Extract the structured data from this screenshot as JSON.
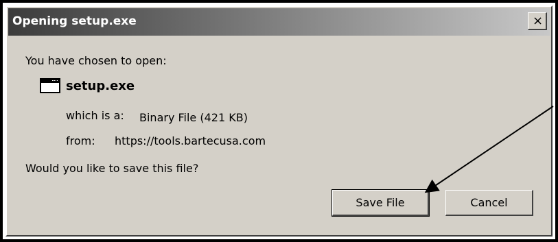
{
  "dialog": {
    "title": "Opening setup.exe",
    "close_glyph": "×",
    "intro": "You have chosen to open:",
    "file": {
      "icon": "application-window-icon",
      "name": "setup.exe",
      "type_label": "which is a:",
      "type_value": "Binary File (421 KB)",
      "from_label": "from:",
      "from_value": "https://tools.bartecusa.com"
    },
    "question": "Would you like to save this file?",
    "buttons": {
      "save": "Save File",
      "cancel": "Cancel"
    }
  },
  "annotation": {
    "arrow_color": "#000000",
    "points_to": "save-file-button"
  }
}
